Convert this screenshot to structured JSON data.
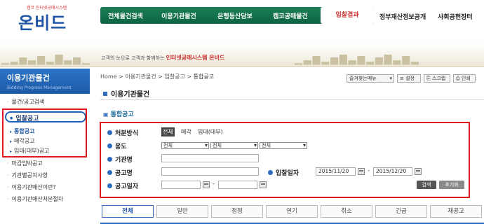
{
  "logo": {
    "title": "온비드",
    "subtitle": "캠코 인터넷공매시스템"
  },
  "gnb": {
    "items": [
      "전체물건검색",
      "이용기관물건",
      "은행동산담보",
      "캠코공매물건",
      "입찰결과"
    ],
    "outside": [
      "정부재산정보공개",
      "사회공헌장터"
    ]
  },
  "banner": {
    "text": "고객의 눈으로 고객과 함께하는",
    "highlight": "인터넷공매시스템 온비드"
  },
  "sidebar": {
    "title": "이용기관물건",
    "subtitle": "Bidding Progress Management",
    "items": [
      "물건/공고검색",
      "입찰공고",
      "마감임박공고",
      "기관별공지사항",
      "이용기관매산이란?",
      "이용기관매산처분절차"
    ],
    "sub_items": [
      "통합공고",
      "매각공고",
      "임대(대부)공고"
    ]
  },
  "breadcrumb": {
    "home": "Home",
    "path": [
      "이용기관물건",
      "입찰공고",
      "통합공고"
    ]
  },
  "toolbar": {
    "menu": "즐겨찾는메뉴",
    "settings": "설정",
    "scrap": "스크랩",
    "print": "인쇄"
  },
  "page": {
    "title": "이용기관물건",
    "section": "통합공고"
  },
  "form": {
    "disposal_label": "처분방식",
    "disposal_options": [
      "전체",
      "매각",
      "임대(대부)"
    ],
    "usage_label": "용도",
    "usage_selects": [
      "전체",
      "전체",
      "전체"
    ],
    "agency_label": "기관명",
    "notice_name_label": "공고명",
    "bid_date_label": "입찰일자",
    "bid_date_from": "2015/11/20",
    "bid_date_to": "2015/12/20",
    "notice_date_label": "공고일자",
    "search_btn": "검색",
    "reset_btn": "초기화"
  },
  "tabs": [
    "전체",
    "일반",
    "정정",
    "연기",
    "취소",
    "긴급",
    "재공고"
  ]
}
